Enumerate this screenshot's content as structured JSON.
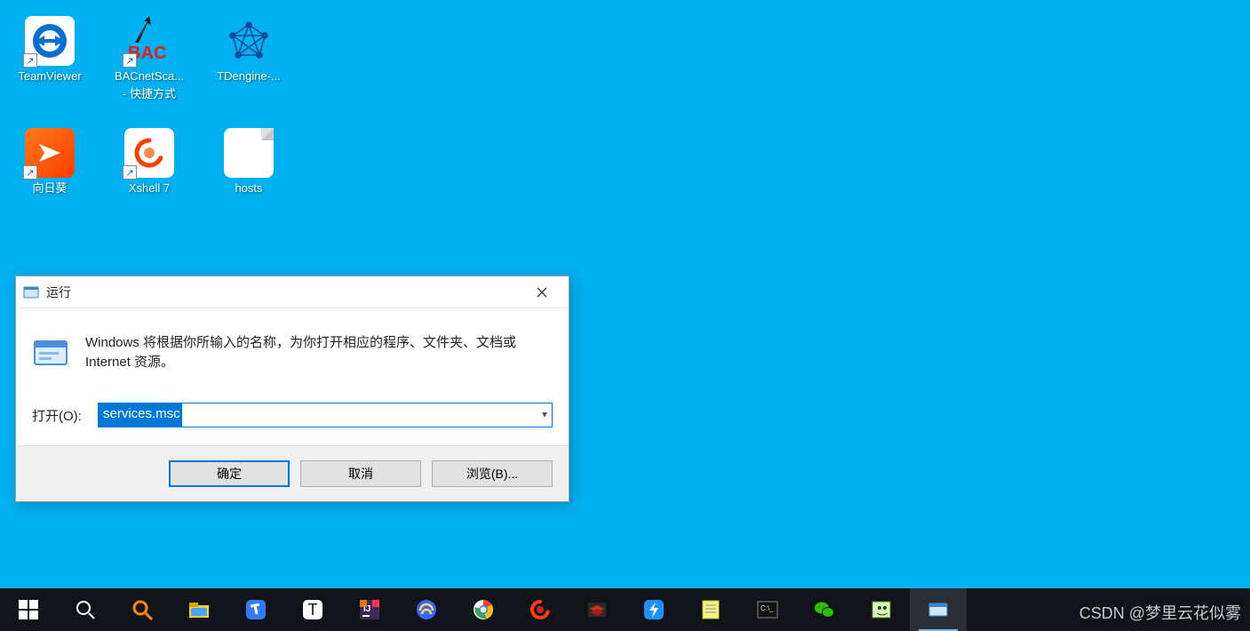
{
  "desktop": {
    "icons": [
      {
        "name": "teamviewer",
        "label": "TeamViewer",
        "sublabel": ""
      },
      {
        "name": "bacnet",
        "label": "BACnetSca...",
        "sublabel": "- 快捷方式"
      },
      {
        "name": "tdengine",
        "label": "TDengine-...",
        "sublabel": ""
      },
      {
        "name": "sunflower",
        "label": "向日葵",
        "sublabel": ""
      },
      {
        "name": "xshell",
        "label": "Xshell 7",
        "sublabel": ""
      },
      {
        "name": "hosts",
        "label": "hosts",
        "sublabel": ""
      }
    ]
  },
  "run_dialog": {
    "title": "运行",
    "description": "Windows 将根据你所输入的名称，为你打开相应的程序、文件夹、文档或 Internet 资源。",
    "input_label": "打开(O):",
    "input_value": "services.msc",
    "ok": "确定",
    "cancel": "取消",
    "browse": "浏览(B)..."
  },
  "taskbar": {
    "items": [
      {
        "name": "start",
        "kind": "win"
      },
      {
        "name": "search",
        "kind": "search-white"
      },
      {
        "name": "everything",
        "kind": "search-orange"
      },
      {
        "name": "file-explorer",
        "kind": "explorer"
      },
      {
        "name": "todesk",
        "kind": "todesk"
      },
      {
        "name": "typora",
        "kind": "letter-T"
      },
      {
        "name": "intellij",
        "kind": "intellij"
      },
      {
        "name": "navicat",
        "kind": "navicat"
      },
      {
        "name": "chrome",
        "kind": "chrome"
      },
      {
        "name": "sunflower",
        "kind": "sunflower-small"
      },
      {
        "name": "redis",
        "kind": "redis"
      },
      {
        "name": "thunder",
        "kind": "thunder"
      },
      {
        "name": "notepad",
        "kind": "notepad"
      },
      {
        "name": "cmd",
        "kind": "cmd"
      },
      {
        "name": "wechat",
        "kind": "wechat"
      },
      {
        "name": "notepadpp",
        "kind": "npp"
      },
      {
        "name": "run-active",
        "kind": "run",
        "active": true
      }
    ]
  },
  "watermark": "CSDN @梦里云花似雾"
}
